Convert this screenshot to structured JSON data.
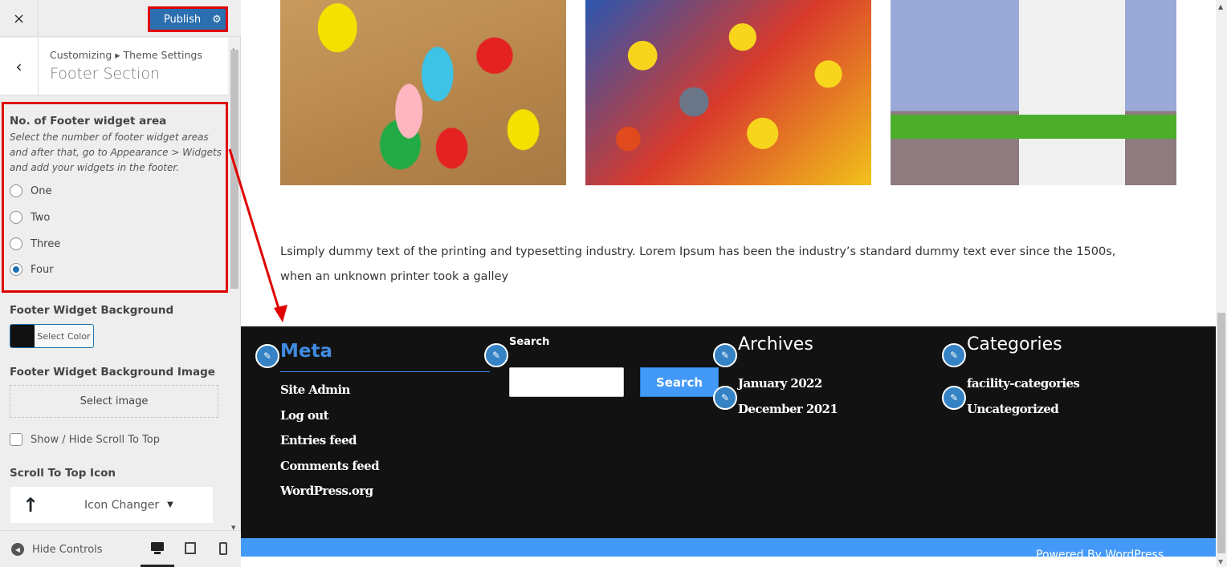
{
  "sidebar": {
    "close_icon": "×",
    "publish_label": "Publish",
    "gear_icon": "⚙",
    "back_icon": "‹",
    "breadcrumb": "Customizing ▸ Theme Settings",
    "section_title": "Footer Section",
    "footer_widget_area": {
      "title": "No. of Footer widget area",
      "description": "Select the number of footer widget areas and after that, go to Appearance > Widgets and add your widgets in the footer.",
      "options": [
        "One",
        "Two",
        "Three",
        "Four"
      ],
      "selected": "Four"
    },
    "bg_color": {
      "title": "Footer Widget Background",
      "button_label": "Select Color",
      "value": "#111111"
    },
    "bg_image": {
      "title": "Footer Widget Background Image",
      "button_label": "Select image"
    },
    "scroll_top_toggle": {
      "label": "Show / Hide Scroll To Top",
      "checked": false
    },
    "scroll_top_icon": {
      "title": "Scroll To Top Icon",
      "icon": "🠕",
      "label": "Icon Changer",
      "chevron": "⌄"
    },
    "hide_controls_label": "Hide Controls",
    "devices": [
      "desktop",
      "tablet",
      "mobile"
    ],
    "active_device": "desktop"
  },
  "preview": {
    "images": [
      "colorful-alphabet-letters",
      "rubber-ducks",
      "lego-house"
    ],
    "lorem": "Lsimply dummy text of the printing and typesetting industry. Lorem Ipsum has been the industry’s standard dummy text ever since the 1500s, when an unknown printer took a galley",
    "footer": {
      "meta": {
        "title": "Meta",
        "links": [
          "Site Admin",
          "Log out",
          "Entries feed",
          "Comments feed",
          "WordPress.org"
        ]
      },
      "search": {
        "label": "Search",
        "input_value": "",
        "button_label": "Search"
      },
      "archives": {
        "title": "Archives",
        "links": [
          "January 2022",
          "December 2021"
        ]
      },
      "categories": {
        "title": "Categories",
        "links": [
          "facility-categories",
          "Uncategorized"
        ]
      },
      "edit_icon": "✎",
      "powered_by": "Powered By WordPress"
    }
  },
  "colors": {
    "publish": "#2b6fb0",
    "highlight": "#e00000",
    "footer_bg": "#121212",
    "accent_blue": "#4399f7",
    "meta_title": "#3f8be0"
  }
}
